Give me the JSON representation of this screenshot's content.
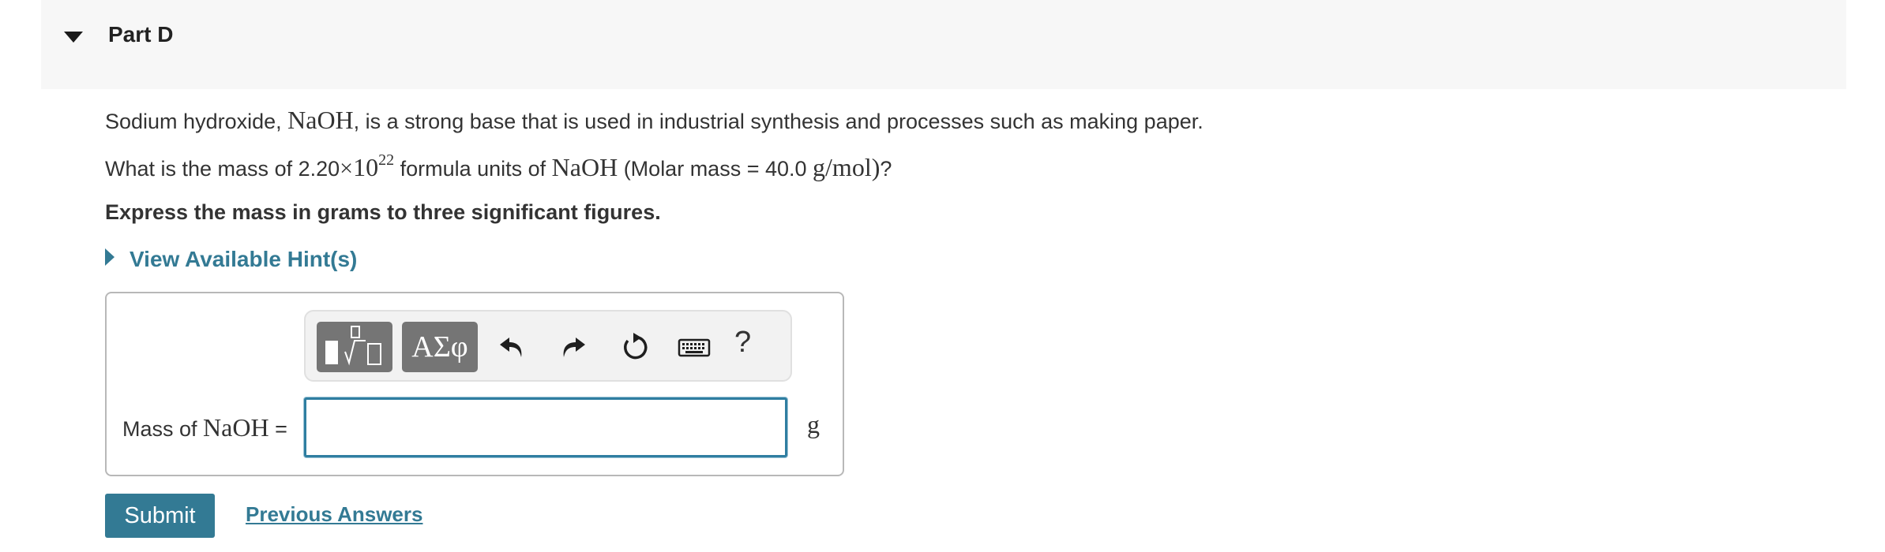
{
  "part": {
    "title": "Part D"
  },
  "question": {
    "line1_pre": "Sodium hydroxide, ",
    "line1_formula": "NaOH",
    "line1_post": ", is a strong base that is used in industrial synthesis and processes such as making paper.",
    "line2_pre": "What is the mass of 2.20",
    "line2_times": "×",
    "line2_base": "10",
    "line2_exp": "22",
    "line2_mid": " formula units of ",
    "line2_formula": "NaOH",
    "line2_paren_pre": " (Molar mass = 40.0 ",
    "line2_unit": "g/mol)",
    "line2_post": "?",
    "instruction": "Express the mass in grams to three significant figures."
  },
  "hints": {
    "label": "View Available Hint(s)"
  },
  "toolbar": {
    "templates_icon": "fraction-sqrt-template-icon",
    "greek_label": "ΑΣφ",
    "undo_icon": "undo-icon",
    "redo_icon": "redo-icon",
    "reset_icon": "reset-icon",
    "keyboard_icon": "keyboard-icon",
    "help_label": "?"
  },
  "answer": {
    "label_pre": "Mass of ",
    "label_formula": "NaOH",
    "label_eq": " =",
    "value": "",
    "unit": "g"
  },
  "actions": {
    "submit_label": "Submit",
    "previous_answers_label": "Previous Answers"
  },
  "colors": {
    "accent": "#337a94",
    "header_bg": "#f7f7f7",
    "toolbar_btn": "#757575",
    "input_border": "#2f7ea1"
  }
}
